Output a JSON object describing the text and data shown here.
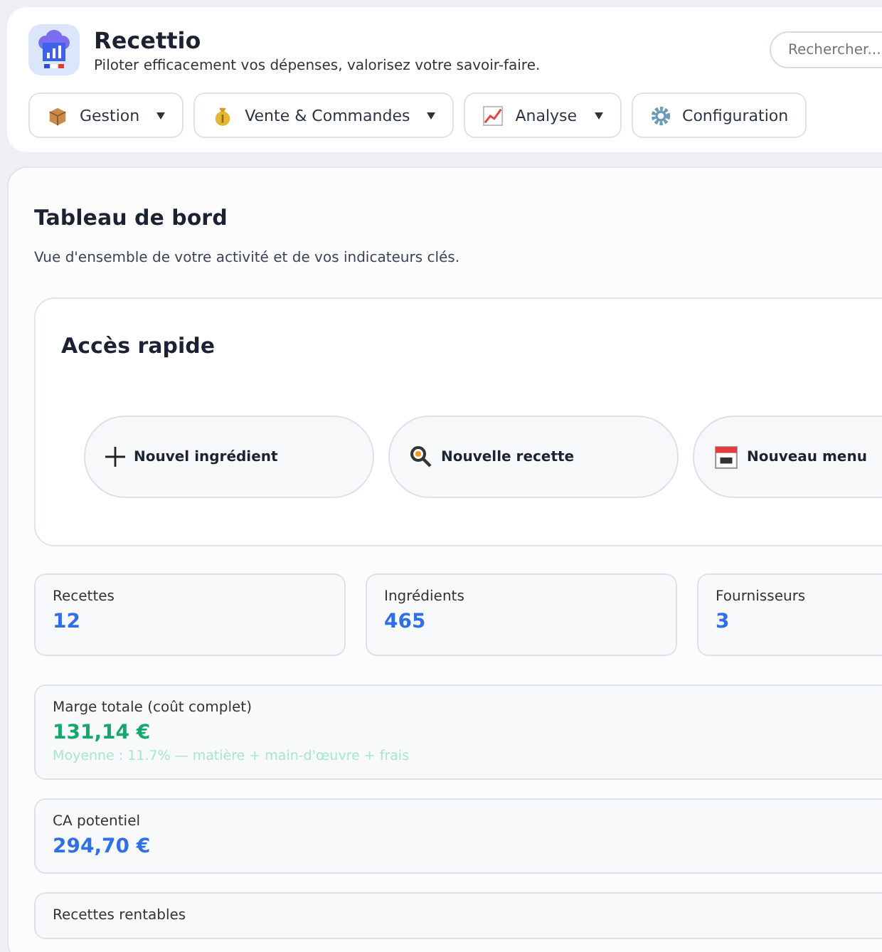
{
  "app": {
    "title": "Recettio",
    "tagline": "Piloter efficacement vos dépenses, valorisez votre savoir-faire."
  },
  "search": {
    "placeholder": "Rechercher..."
  },
  "nav": [
    {
      "kind": "box",
      "label": "Gestion",
      "dropdown": true
    },
    {
      "kind": "money",
      "label": "Vente & Commandes",
      "dropdown": true
    },
    {
      "kind": "chart",
      "label": "Analyse",
      "dropdown": true
    },
    {
      "kind": "gear",
      "label": "Configuration",
      "dropdown": false
    }
  ],
  "dashboard": {
    "title": "Tableau de bord",
    "subtitle": "Vue d'ensemble de votre activité et de vos indicateurs clés."
  },
  "quick_access": {
    "title": "Accès rapide",
    "actions": [
      {
        "kind": "plus",
        "label": "Nouvel ingrédient"
      },
      {
        "kind": "search",
        "label": "Nouvelle recette"
      },
      {
        "kind": "calendar",
        "label": "Nouveau menu"
      }
    ]
  },
  "stats": [
    {
      "label": "Recettes",
      "value": "12",
      "color": "#2f6fe8"
    },
    {
      "label": "Ingrédients",
      "value": "465",
      "color": "#2f6fe8"
    },
    {
      "label": "Fournisseurs",
      "value": "3",
      "color": "#2f6fe8"
    }
  ],
  "metrics": [
    {
      "label": "Marge totale (coût complet)",
      "value": "131,14 €",
      "color": "#14a86b",
      "note": "Moyenne : 11.7% — matière + main-d'œuvre + frais"
    },
    {
      "label": "CA potentiel",
      "value": "294,70 €",
      "color": "#2f6fe8"
    },
    {
      "label": "Recettes rentables"
    }
  ]
}
